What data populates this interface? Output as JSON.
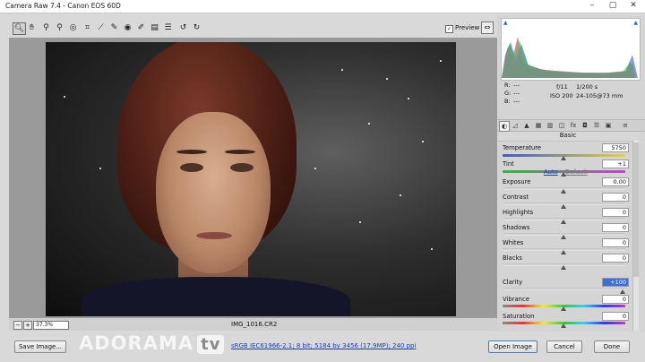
{
  "window": {
    "title": "Camera Raw 7.4  -  Canon EOS 60D",
    "min": "–",
    "max": "▢",
    "close": "✕"
  },
  "toolbar": {
    "tools": [
      "zoom-tool",
      "hand-tool",
      "white-balance-tool",
      "color-sampler-tool",
      "targeted-adjustment-tool",
      "crop-tool",
      "straighten-tool",
      "spot-removal-tool",
      "red-eye-tool",
      "adjustment-brush-tool",
      "graduated-filter-tool",
      "radial-filter-tool",
      "preferences-tool",
      "rotate-left-tool",
      "rotate-right-tool"
    ],
    "preview_label": "Preview",
    "preview_checked": true
  },
  "photo": {
    "filename": "IMG_1016.CR2"
  },
  "statusbar": {
    "zoom_out": "−",
    "zoom_in": "+",
    "zoom_value": "37.3%"
  },
  "bottom": {
    "save_label": "Save Image...",
    "workflow_link": "sRGB IEC61966-2.1; 8 bit; 5184 by 3456 (17.9MP); 240 ppi",
    "open_label": "Open Image",
    "cancel_label": "Cancel",
    "done_label": "Done",
    "watermark": "ADORAMA",
    "watermark_tv": "tv"
  },
  "info": {
    "r": "R:",
    "g": "G:",
    "b": "B:",
    "r_val": "---",
    "g_val": "---",
    "b_val": "---",
    "aperture": "f/11",
    "shutter": "1/200 s",
    "iso": "ISO 200",
    "lens": "24-105@73 mm"
  },
  "panel": {
    "section_title": "Basic",
    "auto_label": "Auto",
    "default_label": "Default",
    "sliders": [
      {
        "label": "Temperature",
        "value": "5750",
        "position": 0.5
      },
      {
        "label": "Tint",
        "value": "+1",
        "position": 0.5
      },
      {
        "label": "Exposure",
        "value": "0.00",
        "position": 0.5
      },
      {
        "label": "Contrast",
        "value": "0",
        "position": 0.5
      },
      {
        "label": "Highlights",
        "value": "0",
        "position": 0.5
      },
      {
        "label": "Shadows",
        "value": "0",
        "position": 0.5
      },
      {
        "label": "Whites",
        "value": "0",
        "position": 0.5
      },
      {
        "label": "Blacks",
        "value": "0",
        "position": 0.5
      },
      {
        "label": "Clarity",
        "value": "+100",
        "position": 1.0
      },
      {
        "label": "Vibrance",
        "value": "0",
        "position": 0.5
      },
      {
        "label": "Saturation",
        "value": "0",
        "position": 0.5
      }
    ]
  },
  "colors": {
    "link": "#1b3fb0",
    "selection": "#3d6fd8",
    "primary_border": "#3f7fc0"
  }
}
